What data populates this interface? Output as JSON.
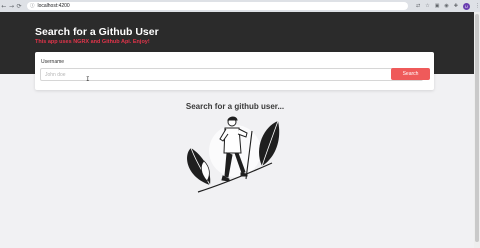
{
  "browser": {
    "url": "localhost:4200",
    "back_icon": "arrow-left-icon",
    "forward_icon": "arrow-right-icon",
    "reload_icon": "reload-icon",
    "profile_initial": "U"
  },
  "header": {
    "title": "Search for a Github User",
    "subtitle": "This app uses NGRX and Github Api. Enjoy!"
  },
  "search": {
    "label": "Username",
    "placeholder": "John doe",
    "value": "",
    "button_label": "Search"
  },
  "empty_state": {
    "title": "Search for a github user..."
  },
  "colors": {
    "header_bg": "#2b2b2b",
    "accent": "#ef5a5a",
    "subtitle": "#e0344a",
    "page_bg": "#f1f1f3"
  }
}
